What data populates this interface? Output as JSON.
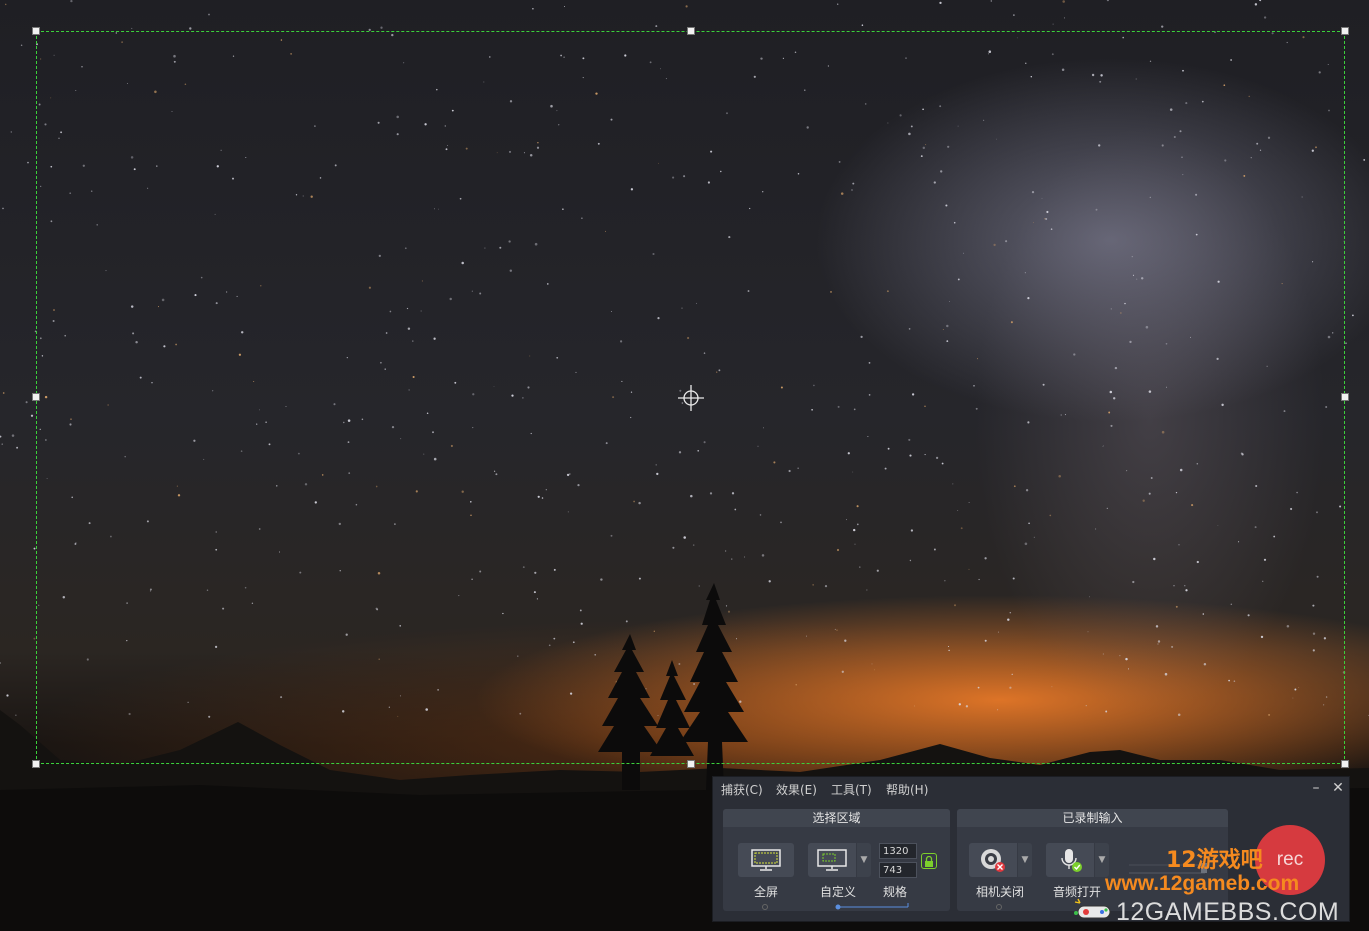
{
  "menu": {
    "capture": "捕获(C)",
    "effects": "效果(E)",
    "tools": "工具(T)",
    "help": "帮助(H)"
  },
  "window_controls": {
    "minimize": "–",
    "close": "✕"
  },
  "select_area": {
    "title": "选择区域",
    "fullscreen_label": "全屏",
    "custom_label": "自定义",
    "size_label": "规格",
    "width": "1320",
    "height": "743"
  },
  "recorded_inputs": {
    "title": "已录制输入",
    "camera_label": "相机关闭",
    "audio_label": "音频打开"
  },
  "record_button": {
    "label": "rec"
  },
  "watermark": {
    "site_name": "12游戏吧",
    "url": "www.12gameb.com",
    "bbs": "12GAMEBBS.COM"
  },
  "colors": {
    "selection_border": "#3bd13b",
    "panel_bg": "#2b2e36",
    "record_red": "#d63a3f",
    "lock_green": "#7ccf2c",
    "watermark_orange": "#f58a1f"
  }
}
